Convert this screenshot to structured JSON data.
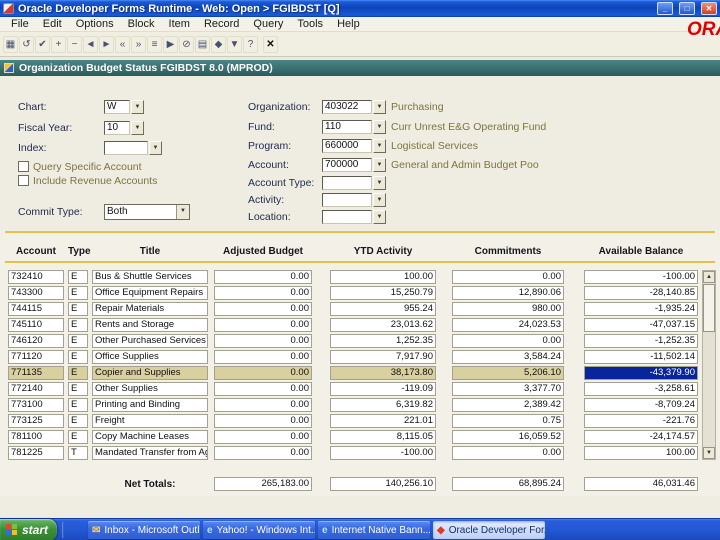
{
  "window": {
    "title": "Oracle Developer Forms Runtime - Web:  Open > FGIBDST [Q]",
    "minimize": "_",
    "maximize": "□",
    "close": "✕"
  },
  "icons": {
    "dropdown": "▼",
    "scroll_up": "▲",
    "scroll_down": "▼",
    "checkmark": "✓"
  },
  "menu": {
    "items": [
      "File",
      "Edit",
      "Options",
      "Block",
      "Item",
      "Record",
      "Query",
      "Tools",
      "Help"
    ],
    "brand": "ORACLE"
  },
  "toolbar": {
    "icons": [
      {
        "name": "save",
        "glyph": "▦"
      },
      {
        "name": "rollback",
        "glyph": "↺"
      },
      {
        "name": "select",
        "glyph": "✔"
      },
      {
        "name": "insert-record",
        "glyph": "+"
      },
      {
        "name": "remove-record",
        "glyph": "−"
      },
      {
        "name": "previous-record",
        "glyph": "◄"
      },
      {
        "name": "next-record",
        "glyph": "►"
      },
      {
        "name": "previous-block",
        "glyph": "«"
      },
      {
        "name": "next-block",
        "glyph": "»"
      },
      {
        "name": "enter-query",
        "glyph": "≡"
      },
      {
        "name": "execute-query",
        "glyph": "▶"
      },
      {
        "name": "cancel-query",
        "glyph": "⊘"
      },
      {
        "name": "print",
        "glyph": "▤"
      },
      {
        "name": "direct-access",
        "glyph": "◆"
      },
      {
        "name": "view-related-menu",
        "glyph": "▼"
      },
      {
        "name": "online-help",
        "glyph": "?"
      },
      {
        "name": "exit",
        "glyph": "✕"
      }
    ]
  },
  "form": {
    "header": {
      "title": "Organization Budget Status  FGIBDST 8.0 (MPROD)"
    },
    "left": {
      "lov_fields": [
        {
          "label": "Chart:",
          "value": "W"
        },
        {
          "label": "Fiscal Year:",
          "value": "10"
        },
        {
          "label": "Index:",
          "value": ""
        }
      ],
      "checkboxes": [
        {
          "label": "Query Specific Account",
          "checked": false
        },
        {
          "label": "Include Revenue Accounts",
          "checked": false
        }
      ],
      "commit_type": {
        "label": "Commit Type:",
        "value": "Both"
      }
    },
    "right_fields": [
      {
        "label": "Organization:",
        "value": "403022",
        "desc": "Purchasing"
      },
      {
        "label": "Fund:",
        "value": "110",
        "desc": "Curr Unrest E&G Operating Fund"
      },
      {
        "label": "Program:",
        "value": "660000",
        "desc": "Logistical Services"
      },
      {
        "label": "Account:",
        "value": "700000",
        "desc": "General and Admin Budget Poo"
      },
      {
        "label": "Account Type:",
        "value": "",
        "desc": ""
      },
      {
        "label": "Activity:",
        "value": "",
        "desc": ""
      },
      {
        "label": "Location:",
        "value": "",
        "desc": ""
      }
    ]
  },
  "table": {
    "columns": [
      {
        "key": "account",
        "label": "Account"
      },
      {
        "key": "type",
        "label": "Type"
      },
      {
        "key": "title",
        "label": "Title"
      },
      {
        "key": "adjusted",
        "label": "Adjusted Budget"
      },
      {
        "key": "ytd",
        "label": "YTD Activity"
      },
      {
        "key": "commitments",
        "label": "Commitments"
      },
      {
        "key": "available",
        "label": "Available Balance"
      }
    ],
    "rows": [
      [
        "732410",
        "E",
        "Bus & Shuttle Services",
        "0.00",
        "100.00",
        "0.00",
        "-100.00"
      ],
      [
        "743300",
        "E",
        "Office Equipment Repairs",
        "0.00",
        "15,250.79",
        "12,890.06",
        "-28,140.85"
      ],
      [
        "744115",
        "E",
        "Repair Materials",
        "0.00",
        "955.24",
        "980.00",
        "-1,935.24"
      ],
      [
        "745110",
        "E",
        "Rents and Storage",
        "0.00",
        "23,013.62",
        "24,023.53",
        "-47,037.15"
      ],
      [
        "746120",
        "E",
        "Other Purchased Services",
        "0.00",
        "1,252.35",
        "0.00",
        "-1,252.35"
      ],
      [
        "771120",
        "E",
        "Office Supplies",
        "0.00",
        "7,917.90",
        "3,584.24",
        "-11,502.14"
      ],
      [
        "771135",
        "E",
        "Copier and Supplies",
        "0.00",
        "38,173.80",
        "5,206.10",
        "-43,379.90"
      ],
      [
        "772140",
        "E",
        "Other Supplies",
        "0.00",
        "-119.09",
        "3,377.70",
        "-3,258.61"
      ],
      [
        "773100",
        "E",
        "Printing and Binding",
        "0.00",
        "6,319.82",
        "2,389.42",
        "-8,709.24"
      ],
      [
        "773125",
        "E",
        "Freight",
        "0.00",
        "221.01",
        "0.75",
        "-221.76"
      ],
      [
        "781100",
        "E",
        "Copy Machine Leases",
        "0.00",
        "8,115.05",
        "16,059.52",
        "-24,174.57"
      ],
      [
        "781225",
        "T",
        "Mandated Transfer from Agency",
        "0.00",
        "-100.00",
        "0.00",
        "100.00"
      ]
    ],
    "selected_row": 6,
    "selected_column": "available",
    "net_totals": {
      "label": "Net Totals:",
      "adjusted": "265,183.00",
      "ytd": "140,256.10",
      "commitments": "68,895.24",
      "available": "46,031.46"
    }
  },
  "taskbar": {
    "start_label": "start",
    "buttons": [
      {
        "label": "Inbox - Microsoft Outl...",
        "icon": "outlook",
        "active": false
      },
      {
        "label": "Yahoo! - Windows Int...",
        "icon": "ie",
        "active": false
      },
      {
        "label": "Internet Native Bann...",
        "icon": "ie",
        "active": false
      },
      {
        "label": "Oracle Developer For...",
        "icon": "oracle",
        "active": true
      }
    ]
  },
  "colors": {
    "title_bar": "#0d43b8",
    "form_header": "#356e6e",
    "separator_yellow": "#e5c14b",
    "row_highlight": "#d9d09f",
    "selected_cell": "#08259c",
    "taskbar_blue": "#2257d2",
    "start_green": "#3c9038",
    "brand_red": "#e00000",
    "olive_text": "#7c7440"
  }
}
